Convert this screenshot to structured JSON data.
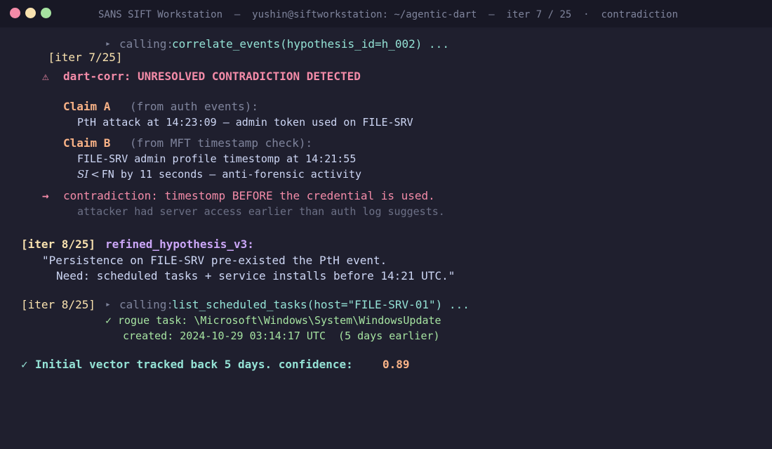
{
  "window": {
    "title": "SANS SIFT Workstation  —  yushin@siftworkstation: ~/agentic-dart  —  iter 7 / 25  ·  contradiction"
  },
  "terminal": {
    "iter7": {
      "tag": "[iter 7/25]",
      "arrow": "▸",
      "calling": "calling:",
      "command": "correlate_events(hypothesis_id=h_002) ..."
    },
    "alert": {
      "icon": "⚠",
      "message": "dart-corr: UNRESOLVED CONTRADICTION DETECTED"
    },
    "claim_a": {
      "label": "Claim A",
      "source": "(from auth events):",
      "detail": "PtH attack at 14:23:09 — admin token used on FILE-SRV"
    },
    "claim_b": {
      "label": "Claim B",
      "source": "(from MFT timestamp check):",
      "detail1": "FILE-SRV admin profile timestomp at 14:21:55",
      "detail2_si": "SI",
      "detail2_lt": "<",
      "detail2_rest": "FN by 11 seconds — anti-forensic activity"
    },
    "contradiction": {
      "arrow": "→",
      "message": "contradiction: timestomp BEFORE the credential is used.",
      "note": "attacker had server access earlier than auth log suggests."
    },
    "iter8": {
      "tag": "[iter 8/25]",
      "label": "refined_hypothesis_v3:",
      "quote1": "\"Persistence on FILE-SRV pre-existed the PtH event.",
      "quote2": "Need: scheduled tasks + service installs before 14:21 UTC.\""
    },
    "iter8b": {
      "tag": "[iter 8/25]",
      "arrow": "▸",
      "calling": "calling:",
      "command": "list_scheduled_tasks(host=\"FILE-SRV-01\") ...",
      "check": "✓",
      "result1": "rogue task: \\Microsoft\\Windows\\System\\WindowsUpdate",
      "result2": "created: 2024-10-29 03:14:17 UTC  (5 days earlier)"
    },
    "final": {
      "check": "✓",
      "message": "Initial vector tracked back 5 days. confidence:",
      "value": "0.89"
    }
  }
}
